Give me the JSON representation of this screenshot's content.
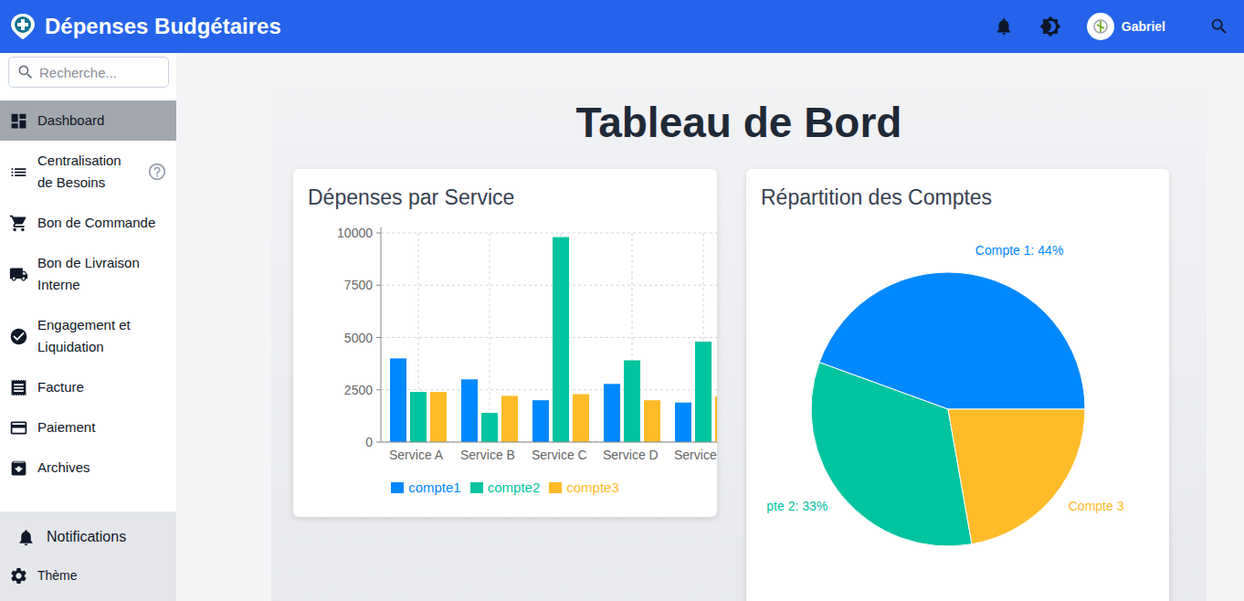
{
  "app": {
    "title": "Dépenses Budgétaires",
    "user": "Gabriel"
  },
  "sidebar": {
    "search_placeholder": "Recherche...",
    "items": [
      {
        "label": "Dashboard",
        "selected": true,
        "help": false
      },
      {
        "label": "Centralisation de Besoins",
        "selected": false,
        "help": true
      },
      {
        "label": "Bon de Commande",
        "selected": false,
        "help": false
      },
      {
        "label": "Bon de Livraison Interne",
        "selected": false,
        "help": false
      },
      {
        "label": "Engagement et Liquidation",
        "selected": false,
        "help": false
      },
      {
        "label": "Facture",
        "selected": false,
        "help": false
      },
      {
        "label": "Paiement",
        "selected": false,
        "help": false
      },
      {
        "label": "Archives",
        "selected": false,
        "help": false
      }
    ],
    "footer": [
      {
        "label": "Notifications",
        "kind": "large"
      },
      {
        "label": "Thème",
        "kind": "small"
      }
    ]
  },
  "page": {
    "title": "Tableau de Bord"
  },
  "bar_chart": {
    "title": "Dépenses par Service",
    "y_max": 10000,
    "y_ticks": [
      "0",
      "2500",
      "5000",
      "7500",
      "10000"
    ],
    "categories": [
      "Service A",
      "Service B",
      "Service C",
      "Service D",
      "Service"
    ],
    "series": [
      {
        "name": "compte1",
        "color": "#0088fe",
        "values": [
          4000,
          3000,
          2000,
          2780,
          1890
        ]
      },
      {
        "name": "compte2",
        "color": "#00c49f",
        "values": [
          2400,
          1398,
          9800,
          3908,
          4800
        ]
      },
      {
        "name": "compte3",
        "color": "#ffbb28",
        "values": [
          2400,
          2210,
          2290,
          2000,
          2181
        ]
      }
    ]
  },
  "pie_chart": {
    "title": "Répartition des Comptes",
    "slices": [
      {
        "label": "Compte 1: 44%",
        "value": 400,
        "color": "#0088fe"
      },
      {
        "label": "pte 2: 33%",
        "value": 300,
        "color": "#00c49f"
      },
      {
        "label": "Compte 3",
        "value": 200,
        "color": "#ffbb28"
      }
    ]
  }
}
